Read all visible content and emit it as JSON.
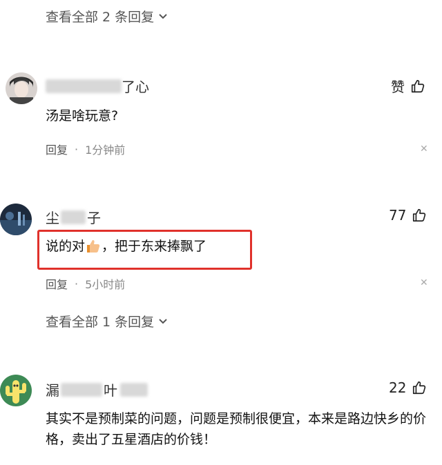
{
  "thread": {
    "view_all_top": "查看全部 2 条回复",
    "view_all_mid": "查看全部 1 条回复"
  },
  "comments": [
    {
      "name_visible": "了心",
      "text": "汤是啥玩意?",
      "reply_label": "回复",
      "time": "1分钟前",
      "like_label": "赞",
      "avatar_icon": "person-avatar",
      "avatar_color": "#c9c2bf"
    },
    {
      "name_prefix": "尘",
      "name_suffix": "子",
      "text_before": "说的对",
      "text_after": "，把于东来捧飘了",
      "reply_label": "回复",
      "time": "5小时前",
      "like_count": "77",
      "avatar_icon": "night-scene-avatar",
      "highlight_color": "#e0312b"
    },
    {
      "name_prefix": "漏",
      "name_mid": "叶",
      "text": "其实不是预制菜的问题，问题是预制很便宜，本来是路边快乡的价格，卖出了五星酒店的价钱！",
      "like_count": "22",
      "avatar_icon": "cactus-avatar",
      "avatar_color": "#3d8a55"
    }
  ],
  "icons": {
    "like": "thumbs-up-icon",
    "close": "close-icon",
    "chevron": "chevron-down-icon",
    "emoji": "thumbs-up-emoji"
  }
}
